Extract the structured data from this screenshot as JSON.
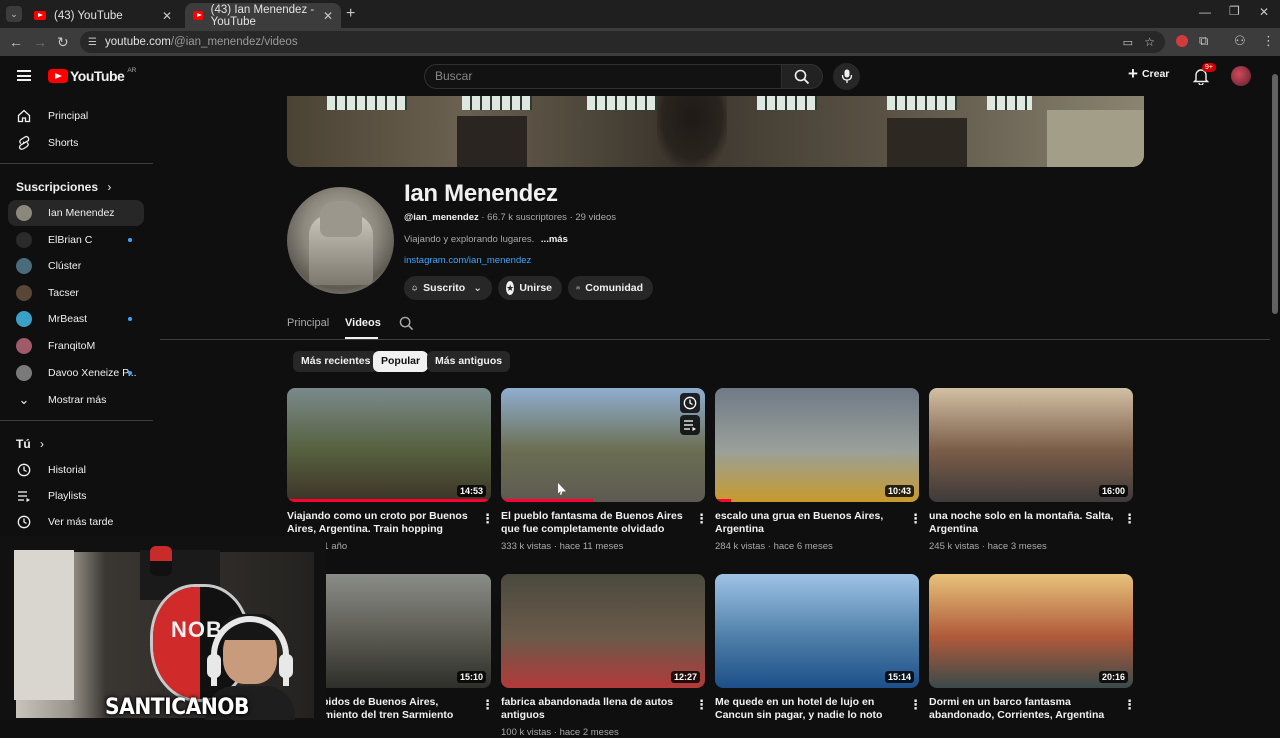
{
  "browser": {
    "tabs": [
      {
        "title": "(43) YouTube",
        "active": false
      },
      {
        "title": "(43) Ian Menendez - YouTube",
        "active": true
      }
    ],
    "url_host": "youtube.com",
    "url_path": "/@ian_menendez/videos"
  },
  "header": {
    "logo": "YouTube",
    "region": "AR",
    "search_placeholder": "Buscar",
    "create_label": "Crear",
    "notif_badge": "9+"
  },
  "sidebar": {
    "main": [
      {
        "label": "Principal",
        "icon": "home-icon"
      },
      {
        "label": "Shorts",
        "icon": "shorts-icon"
      }
    ],
    "subs_heading": "Suscripciones",
    "subs": [
      {
        "label": "Ian Menendez",
        "active": true,
        "dot": false,
        "color": "#8c877d"
      },
      {
        "label": "ElBrian C",
        "active": false,
        "dot": true,
        "color": "#2b2b2b"
      },
      {
        "label": "Clúster",
        "active": false,
        "dot": false,
        "color": "#4a6b7a"
      },
      {
        "label": "Tacser",
        "active": false,
        "dot": false,
        "color": "#5a4636"
      },
      {
        "label": "MrBeast",
        "active": false,
        "dot": true,
        "color": "#3aa0c8"
      },
      {
        "label": "FranqitoM",
        "active": false,
        "dot": false,
        "color": "#a05a6a"
      },
      {
        "label": "Davoo Xeneize P...",
        "active": false,
        "dot": true,
        "color": "#7a7a7a"
      }
    ],
    "show_more": "Mostrar más",
    "you_heading": "Tú",
    "you": [
      {
        "label": "Historial",
        "icon": "history-icon"
      },
      {
        "label": "Playlists",
        "icon": "playlists-icon"
      },
      {
        "label": "Ver más tarde",
        "icon": "watch-later-icon"
      }
    ]
  },
  "channel": {
    "name": "Ian Menendez",
    "handle": "@ian_menendez",
    "subscribers": "· 66.7 k suscriptores",
    "video_count": "· 29 videos",
    "description": "Viajando y explorando lugares.",
    "more": "...más",
    "link": "instagram.com/ian_menendez",
    "buttons": {
      "subscribed": "Suscrito",
      "join": "Unirse",
      "community": "Comunidad"
    },
    "tabs": [
      "Principal",
      "Videos"
    ],
    "active_tab": "Videos",
    "chips": [
      "Más recientes",
      "Popular",
      "Más antiguos"
    ],
    "active_chip": "Popular"
  },
  "videos": [
    {
      "title": "Viajando como un croto por Buenos Aires, Argentina. Train hopping",
      "meta": "s · hace 1 año",
      "duration": "14:53",
      "progress": 0.98,
      "colors": [
        "#7a8a8c",
        "#56603e",
        "#3b3428"
      ]
    },
    {
      "title": "El pueblo fantasma de Buenos Aires que fue completamente olvidado",
      "meta": "333 k vistas · hace 11 meses",
      "duration": "",
      "progress": 0.45,
      "colors": [
        "#8faed0",
        "#6b6e52",
        "#5d5a52"
      ]
    },
    {
      "title": "escalo una grua en Buenos Aires, Argentina",
      "meta": "284 k vistas · hace 6 meses",
      "duration": "10:43",
      "progress": 0.08,
      "colors": [
        "#6f7a86",
        "#9aa09a",
        "#c79a2c"
      ]
    },
    {
      "title": "una noche solo en la montaña. Salta, Argentina",
      "meta": "245 k vistas · hace 3 meses",
      "duration": "16:00",
      "progress": 0,
      "colors": [
        "#d2c0a4",
        "#7a5d48",
        "#3e3a3a"
      ]
    },
    {
      "title": "s prohibidos de Buenos Aires, Soterramiento del tren Sarmiento",
      "meta": "",
      "duration": "15:10",
      "progress": 0,
      "colors": [
        "#8a8c86",
        "#5a5a52",
        "#2e2e2a"
      ]
    },
    {
      "title": "fabrica abandonada llena de autos antiguos",
      "meta": "100 k vistas · hace 2 meses",
      "duration": "12:27",
      "progress": 0,
      "colors": [
        "#4b4a3e",
        "#6a5a4a",
        "#b23a3a"
      ]
    },
    {
      "title": "Me quede en un hotel de lujo en Cancun sin pagar, y nadie lo noto",
      "meta": "",
      "duration": "15:14",
      "progress": 0,
      "colors": [
        "#9ec3e6",
        "#4f7fa8",
        "#1d4f8a"
      ]
    },
    {
      "title": "Dormi en un barco fantasma abandonado, Corrientes, Argentina",
      "meta": "",
      "duration": "20:16",
      "progress": 0,
      "colors": [
        "#e7c27a",
        "#b05a3a",
        "#3a4a4a"
      ]
    }
  ],
  "webcam": {
    "caption": "SANTICANOB",
    "shirt_text": "NOB"
  }
}
